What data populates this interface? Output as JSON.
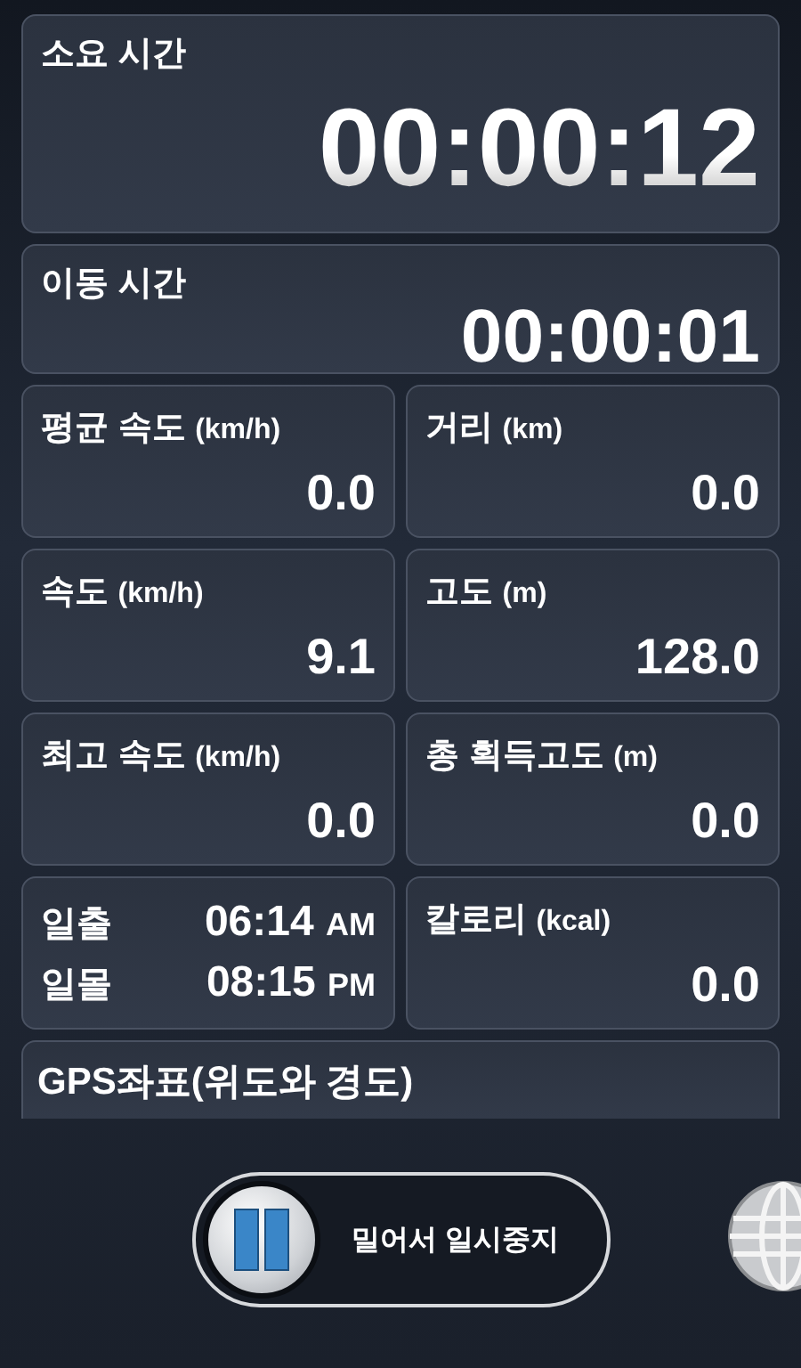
{
  "elapsed": {
    "label": "소요 시간",
    "value": "00:00:12"
  },
  "moving": {
    "label": "이동 시간",
    "value": "00:00:01"
  },
  "stats": [
    {
      "kind": "stat",
      "label": "평균 속도",
      "unit": "(km/h)",
      "value": "0.0"
    },
    {
      "kind": "stat",
      "label": "거리",
      "unit": "(km)",
      "value": "0.0"
    },
    {
      "kind": "stat",
      "label": "속도",
      "unit": "(km/h)",
      "value": "9.1"
    },
    {
      "kind": "stat",
      "label": "고도",
      "unit": "(m)",
      "value": "128.0"
    },
    {
      "kind": "stat",
      "label": "최고 속도",
      "unit": "(km/h)",
      "value": "0.0"
    },
    {
      "kind": "stat",
      "label": "총 획득고도",
      "unit": "(m)",
      "value": "0.0"
    },
    {
      "kind": "sun",
      "rows": [
        {
          "label": "일출",
          "time": "06:14",
          "period": "AM"
        },
        {
          "label": "일몰",
          "time": "08:15",
          "period": "PM"
        }
      ]
    },
    {
      "kind": "stat",
      "label": "칼로리",
      "unit": "(kcal)",
      "value": "0.0"
    }
  ],
  "gps": {
    "label": "GPS좌표(위도와 경도)"
  },
  "slider": {
    "label": "밀어서 일시중지"
  }
}
